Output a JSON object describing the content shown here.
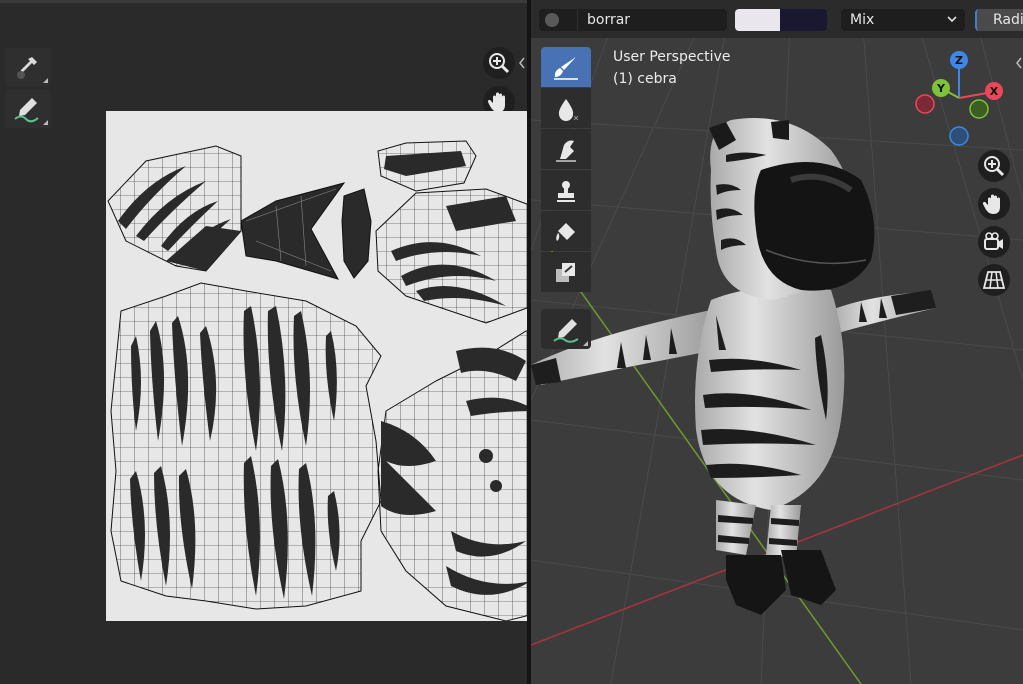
{
  "image_editor": {
    "tools": [
      {
        "name": "sample-tool",
        "icon": "eyedropper-icon"
      },
      {
        "name": "annotate-tool",
        "icon": "pencil-icon"
      }
    ],
    "nav": [
      {
        "name": "zoom-button",
        "icon": "zoom-in-icon"
      },
      {
        "name": "pan-button",
        "icon": "hand-icon"
      }
    ],
    "canvas_colors": {
      "background": "#e7e7e7",
      "paint": "#2a2a2a",
      "wire": "#111111"
    }
  },
  "viewport_header": {
    "brush_name": "borrar",
    "color_primary": "#e9e6ee",
    "color_secondary": "#1a1830",
    "blend_mode": "Mix",
    "radius_label": "Radi"
  },
  "viewport": {
    "view_label": "User Perspective",
    "object_label": "(1) cebra",
    "tools": [
      {
        "name": "draw",
        "icon": "brush-icon"
      },
      {
        "name": "soften",
        "icon": "drop-icon"
      },
      {
        "name": "smear",
        "icon": "smear-icon"
      },
      {
        "name": "clone",
        "icon": "stamp-icon"
      },
      {
        "name": "fill",
        "icon": "bucket-icon"
      },
      {
        "name": "mask",
        "icon": "mask-icon"
      },
      {
        "name": "annotate",
        "icon": "pencil-icon"
      }
    ],
    "gizmo_axes": {
      "z": "Z",
      "y": "Y",
      "x": "X"
    },
    "gizmo_colors": {
      "x": "#e8485a",
      "y": "#7ec23a",
      "z": "#3d88e6"
    },
    "nav": [
      {
        "name": "zoom",
        "icon": "zoom-in-icon"
      },
      {
        "name": "pan",
        "icon": "hand-icon"
      },
      {
        "name": "camera",
        "icon": "camera-icon"
      },
      {
        "name": "ortho",
        "icon": "grid-icon"
      }
    ]
  },
  "colors": {
    "accent": "#4a7bc4",
    "panel": "#2b2b2b",
    "viewport": "#3c3c3c"
  }
}
